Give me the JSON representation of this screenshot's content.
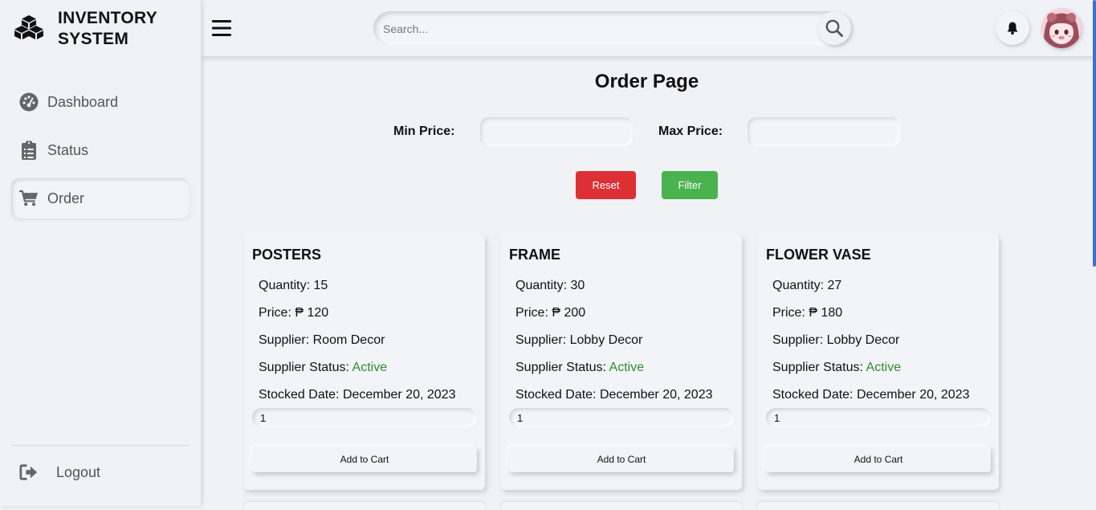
{
  "app": {
    "title_line1": "INVENTORY",
    "title_line2": "SYSTEM"
  },
  "sidebar": {
    "items": [
      {
        "label": "Dashboard",
        "icon": "gauge-icon"
      },
      {
        "label": "Status",
        "icon": "clipboard-icon"
      },
      {
        "label": "Order",
        "icon": "cart-icon",
        "active": true
      }
    ],
    "logout_label": "Logout"
  },
  "header": {
    "search_placeholder": "Search..."
  },
  "page": {
    "title": "Order Page",
    "min_price_label": "Min Price:",
    "max_price_label": "Max Price:",
    "reset_label": "Reset",
    "filter_label": "Filter"
  },
  "products": [
    {
      "name": "POSTERS",
      "quantity_label": "Quantity:",
      "quantity": "15",
      "price_label": "Price:",
      "price": "₱ 120",
      "supplier_label": "Supplier:",
      "supplier": "Room Decor",
      "status_label": "Supplier Status:",
      "status": "Active",
      "date_label": "Stocked Date:",
      "date": "December 20, 2023",
      "qty_value": "1",
      "add_label": "Add to Cart"
    },
    {
      "name": "FRAME",
      "quantity_label": "Quantity:",
      "quantity": "30",
      "price_label": "Price:",
      "price": "₱ 200",
      "supplier_label": "Supplier:",
      "supplier": "Lobby Decor",
      "status_label": "Supplier Status:",
      "status": "Active",
      "date_label": "Stocked Date:",
      "date": "December 20, 2023",
      "qty_value": "1",
      "add_label": "Add to Cart"
    },
    {
      "name": "FLOWER VASE",
      "quantity_label": "Quantity:",
      "quantity": "27",
      "price_label": "Price:",
      "price": "₱ 180",
      "supplier_label": "Supplier:",
      "supplier": "Lobby Decor",
      "status_label": "Supplier Status:",
      "status": "Active",
      "date_label": "Stocked Date:",
      "date": "December 20, 2023",
      "qty_value": "1",
      "add_label": "Add to Cart"
    }
  ],
  "colors": {
    "background": "#f1f2f6",
    "reset": "#dc3035",
    "filter": "#4bb250",
    "active_status": "#2e8b2e",
    "scroll_accent": "#3b6fd4"
  }
}
